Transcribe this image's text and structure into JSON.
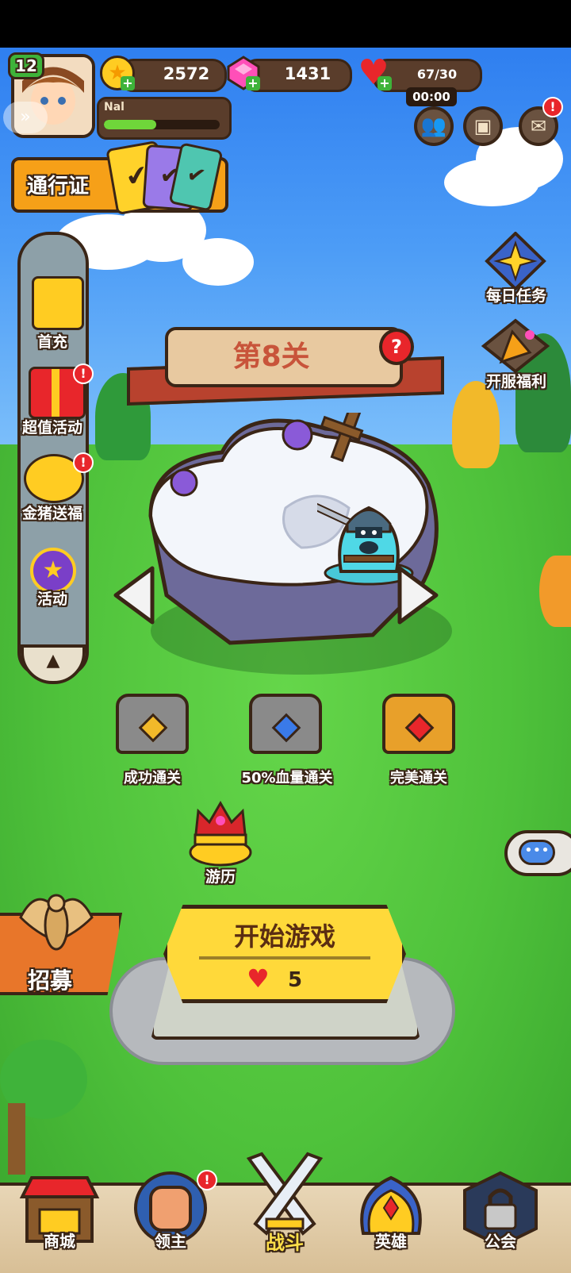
{
  "player": {
    "level": "12",
    "name": "Nal",
    "exp_fraction": 0.45
  },
  "currencies": {
    "gold": "2572",
    "gems": "1431",
    "energy": "67/30",
    "energy_timer": "00:00"
  },
  "pass": {
    "label": "通行证"
  },
  "side_menu": {
    "items": [
      {
        "label": "首充"
      },
      {
        "label": "超值活动"
      },
      {
        "label": "金猪送福"
      },
      {
        "label": "活动"
      }
    ]
  },
  "right_menu": {
    "daily_tasks": "每日任务",
    "server_benefits": "开服福利"
  },
  "stage": {
    "title": "第8关",
    "help": "?"
  },
  "rewards": {
    "chests": [
      {
        "label": "成功通关"
      },
      {
        "label": "50%血量通关"
      },
      {
        "label": "完美通关"
      }
    ]
  },
  "journey": {
    "label": "游历"
  },
  "recruit": {
    "label": "招募"
  },
  "start": {
    "label": "开始游戏",
    "cost": "5"
  },
  "bottom_nav": {
    "items": [
      {
        "label": "商城"
      },
      {
        "label": "领主"
      },
      {
        "label": "战斗"
      },
      {
        "label": "英雄"
      },
      {
        "label": "公会"
      }
    ]
  },
  "alerts": {
    "mark": "!"
  },
  "colors": {
    "accent_orange": "#f6a018",
    "start_yellow": "#ffd93a",
    "alert_red": "#e8262b",
    "banner_red": "#c8543a",
    "panel_brown": "#5a3d2b"
  }
}
